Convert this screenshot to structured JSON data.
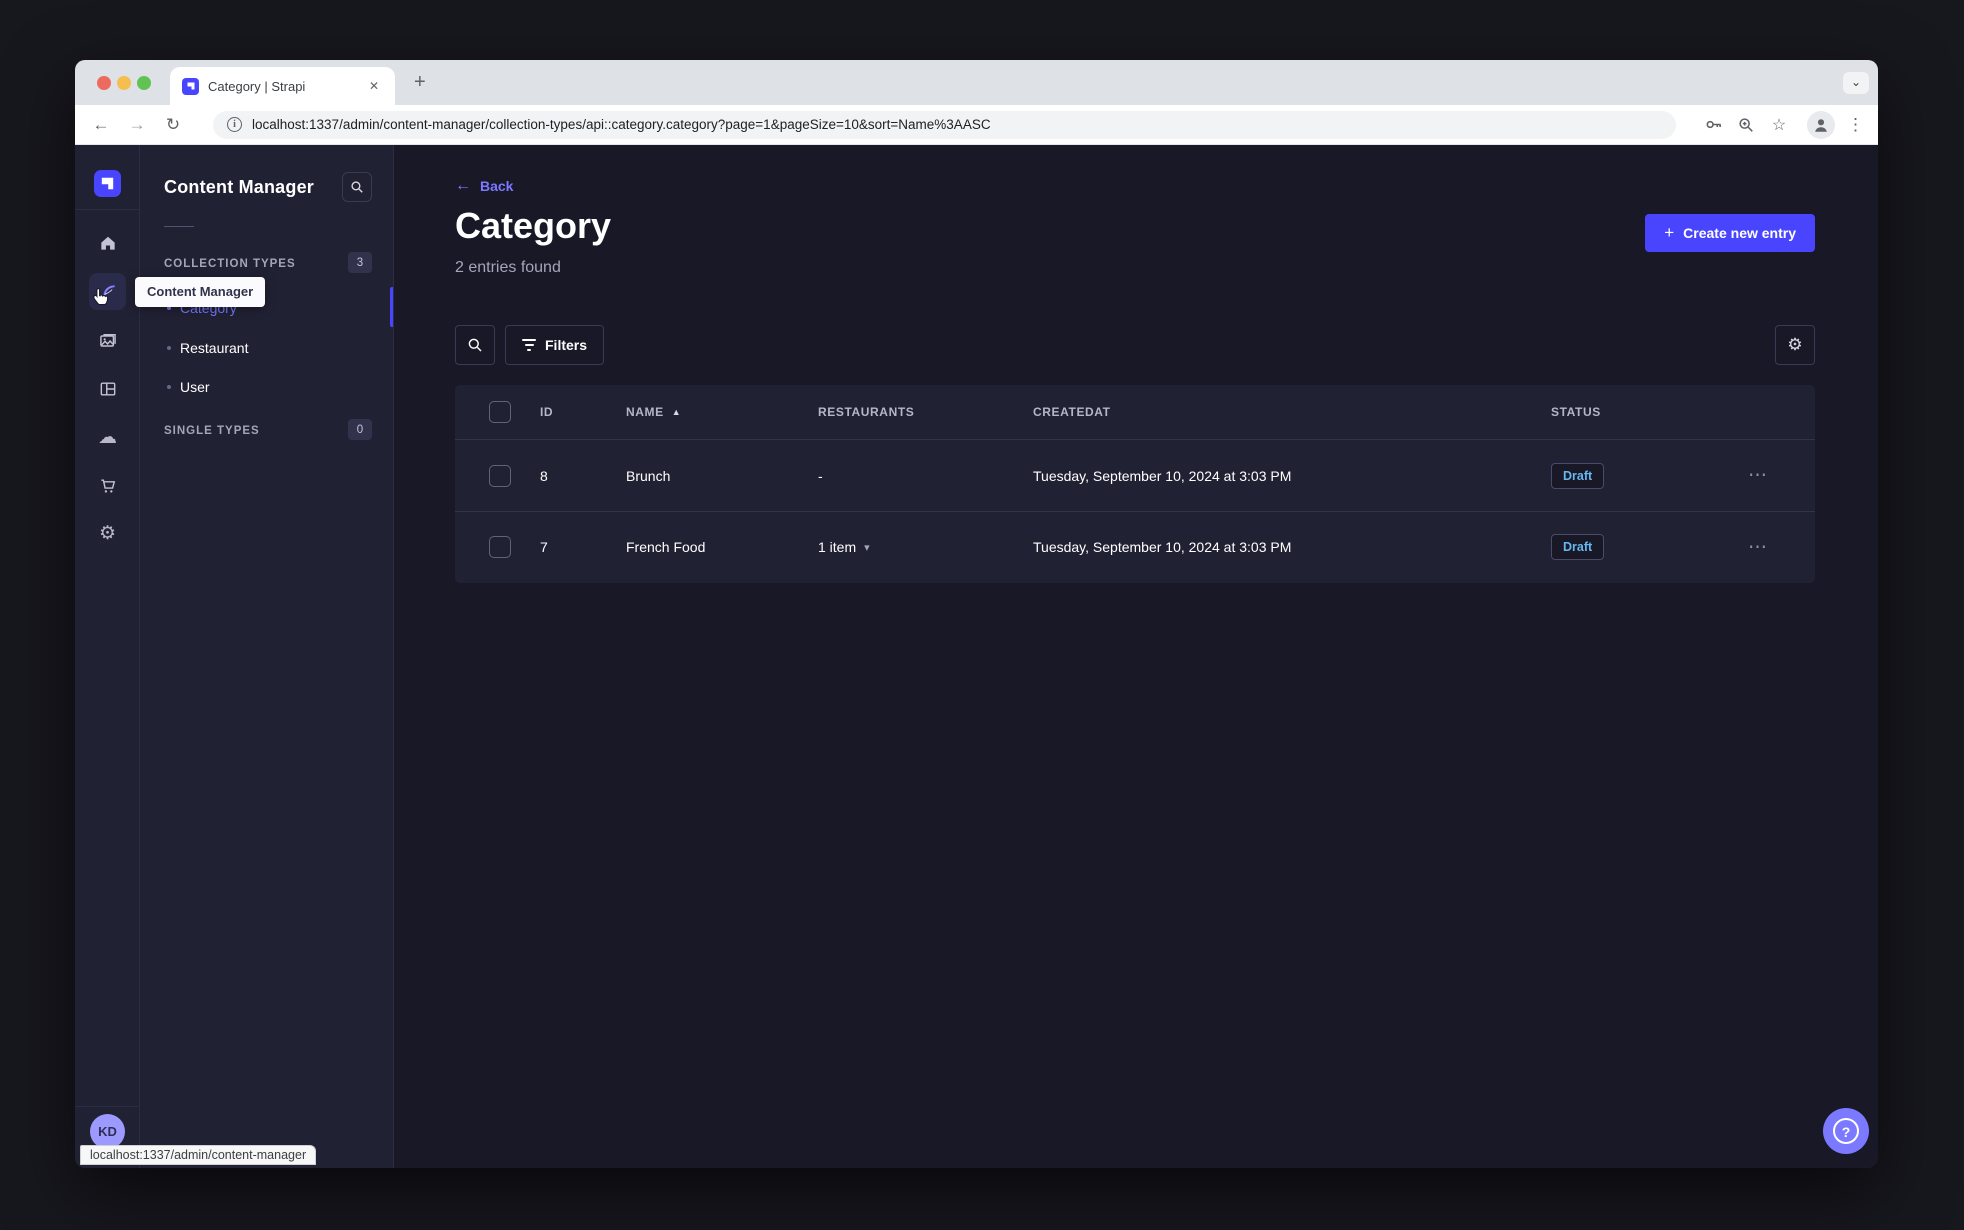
{
  "browser": {
    "tab_title": "Category | Strapi",
    "url": "localhost:1337/admin/content-manager/collection-types/api::category.category?page=1&pageSize=10&sort=Name%3AASC",
    "status_link": "localhost:1337/admin/content-manager"
  },
  "rail": {
    "avatar_initials": "KD"
  },
  "sidebar": {
    "title": "Content Manager",
    "collection_types": {
      "label": "COLLECTION TYPES",
      "count": "3"
    },
    "single_types": {
      "label": "SINGLE TYPES",
      "count": "0"
    },
    "items": [
      {
        "label": "Category",
        "active": true
      },
      {
        "label": "Restaurant",
        "active": false
      },
      {
        "label": "User",
        "active": false
      }
    ]
  },
  "tooltip": {
    "label": "Content Manager"
  },
  "main": {
    "back_label": "Back",
    "page_title": "Category",
    "entries_count": "2 entries found",
    "create_button_label": "Create new entry",
    "filters_label": "Filters"
  },
  "table": {
    "headers": {
      "id": "ID",
      "name": "NAME",
      "restaurants": "RESTAURANTS",
      "createdat": "CREATEDAT",
      "status": "STATUS"
    },
    "rows": [
      {
        "id": "8",
        "name": "Brunch",
        "restaurants": "-",
        "createdat": "Tuesday, September 10, 2024 at 3:03 PM",
        "status": "Draft"
      },
      {
        "id": "7",
        "name": "French Food",
        "restaurants": "1 item",
        "createdat": "Tuesday, September 10, 2024 at 3:03 PM",
        "status": "Draft"
      }
    ]
  },
  "glyphs": {
    "back_arrow": "←",
    "sort_asc": "▲",
    "chevron_down": "▾",
    "strip_chevron": "⌄",
    "dots_h": "⋯",
    "dots_v": "⋮",
    "close": "✕",
    "plus": "+",
    "new_tab": "+",
    "cloud": "☁",
    "gear": "⚙",
    "star": "☆",
    "reload": "↻",
    "info": "i",
    "question": "?",
    "nav_back": "←",
    "nav_forward": "→"
  },
  "colors": {
    "primary": "#4945ff",
    "primary_light": "#7b79ff",
    "draft_text": "#66b7f1",
    "page_bg": "#181826",
    "card_bg": "#212134",
    "desktop_bg": "#17171e"
  }
}
